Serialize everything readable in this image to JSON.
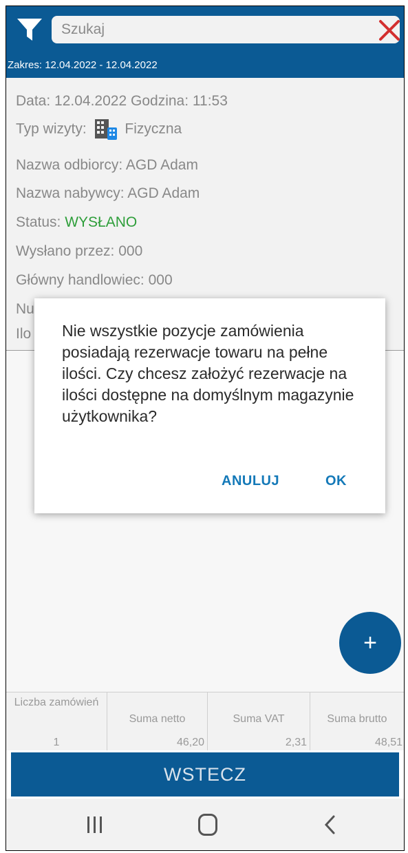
{
  "search": {
    "placeholder": "Szukaj"
  },
  "range": {
    "label": "Zakres:",
    "value": "12.04.2022 - 12.04.2022"
  },
  "details": {
    "date_label": "Data:",
    "date_value": "12.04.2022",
    "time_label": "Godzina:",
    "time_value": "11:53",
    "visit_type_label": "Typ wizyty:",
    "visit_type_value": "Fizyczna",
    "recipient_label": "Nazwa odbiorcy:",
    "recipient_value": "AGD Adam",
    "buyer_label": "Nazwa nabywcy:",
    "buyer_value": "AGD Adam",
    "status_label": "Status:",
    "status_value": "WYSŁANO",
    "sent_by_label": "Wysłano przez:",
    "sent_by_value": "000",
    "salesman_label": "Główny handlowiec:",
    "salesman_value": "000",
    "partial_row_1": "Nu",
    "partial_row_2": "Ilo"
  },
  "dialog": {
    "message": "Nie wszystkie pozycje zamówienia posiadają rezerwacje towaru na pełne ilości. Czy chcesz założyć rezerwacje na ilości dostępne na domyślnym magazynie użytkownika?",
    "cancel_label": "ANULUJ",
    "ok_label": "OK"
  },
  "fab": {
    "label": "+"
  },
  "summary": {
    "headers": [
      "Liczba zamówień",
      "Suma netto",
      "Suma VAT",
      "Suma brutto"
    ],
    "values": [
      "1",
      "46,20",
      "2,31",
      "48,51"
    ]
  },
  "back_button": {
    "label": "WSTECZ"
  },
  "colors": {
    "brand": "#0b5a94",
    "status_ok": "#2e9e3a",
    "dialog_button": "#1479b8",
    "close_icon": "#d32f2f"
  }
}
